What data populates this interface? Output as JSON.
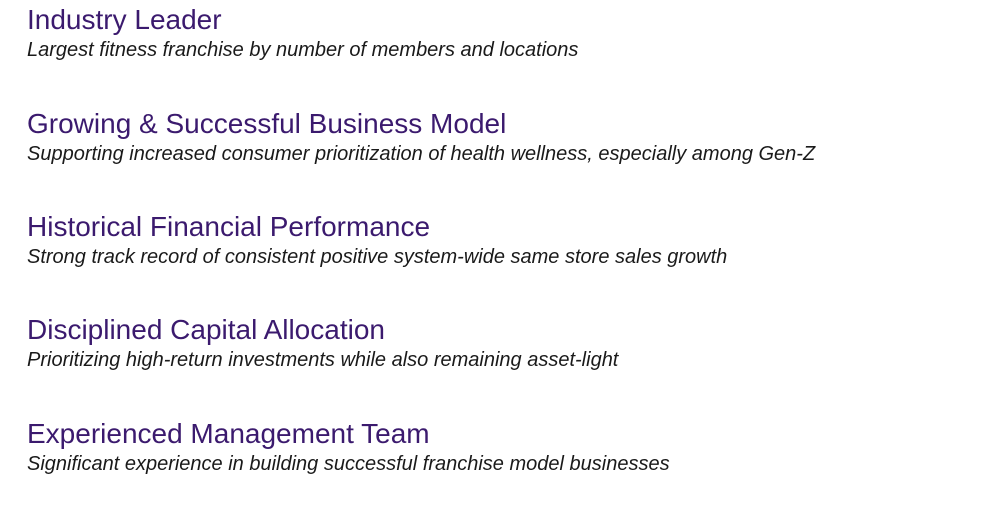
{
  "items": [
    {
      "heading": "Industry Leader",
      "description": "Largest fitness franchise by number of members and locations"
    },
    {
      "heading": "Growing & Successful Business Model",
      "description": "Supporting increased consumer prioritization of health wellness, especially among Gen-Z"
    },
    {
      "heading": "Historical Financial Performance",
      "description": "Strong track record of consistent positive system-wide same store sales growth"
    },
    {
      "heading": "Disciplined Capital Allocation",
      "description": "Prioritizing high-return investments while also remaining asset-light"
    },
    {
      "heading": "Experienced Management Team",
      "description": "Significant experience in building successful franchise model businesses"
    }
  ],
  "colors": {
    "heading": "#3b1a6e",
    "description": "#1a1a1a",
    "background": "#ffffff"
  }
}
